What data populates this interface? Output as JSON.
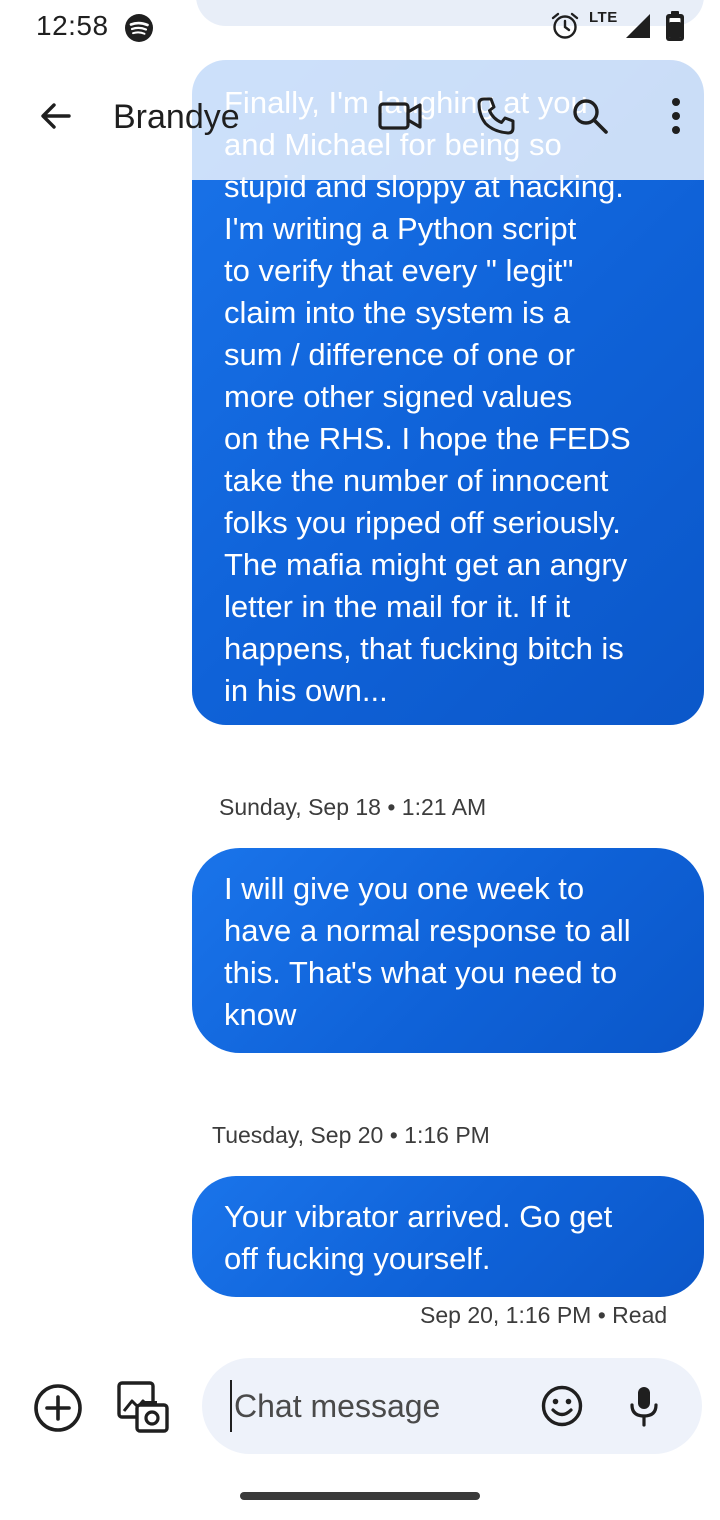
{
  "status_bar": {
    "time": "12:58",
    "network": "LTE",
    "icons": [
      "spotify-icon",
      "alarm-icon",
      "signal-icon",
      "battery-icon"
    ]
  },
  "header": {
    "contact_name": "Brandye",
    "actions": [
      "back-arrow-icon",
      "video-call-icon",
      "phone-call-icon",
      "search-icon",
      "more-vert-icon"
    ]
  },
  "messages": [
    {
      "sender": "me",
      "text": "Finally, I'm laughing at you\nand Michael for being so\nstupid and sloppy at hacking.\nI'm writing a Python script\nto verify that every \" legit\"\nclaim into the system is a\nsum / difference of one or\nmore other signed values\non the RHS. I hope the FEDS\ntake the number of innocent\nfolks you ripped off seriously.\nThe mafia might get an angry\nletter in the mail for it. If it\nhappens, that fucking bitch is\nin his own..."
    },
    {
      "sender": "me",
      "date_separator": "Sunday, Sep 18 • 1:21 AM",
      "text": "I will give you one week to\nhave a normal response to all\nthis. That's what you need to\nknow"
    },
    {
      "sender": "me",
      "date_separator": "Tuesday, Sep 20 • 1:16 PM",
      "text": "Your vibrator arrived. Go  get\noff fucking yourself.",
      "status": "Sep 20, 1:16 PM • Read"
    }
  ],
  "compose": {
    "placeholder": "Chat message",
    "value": "",
    "icons": [
      "add-icon",
      "gallery-icon",
      "emoji-icon",
      "mic-icon"
    ]
  },
  "colors": {
    "bubble": "#1a6be3",
    "compose_bg": "#eef2fa",
    "text": "#1f1f1f"
  }
}
